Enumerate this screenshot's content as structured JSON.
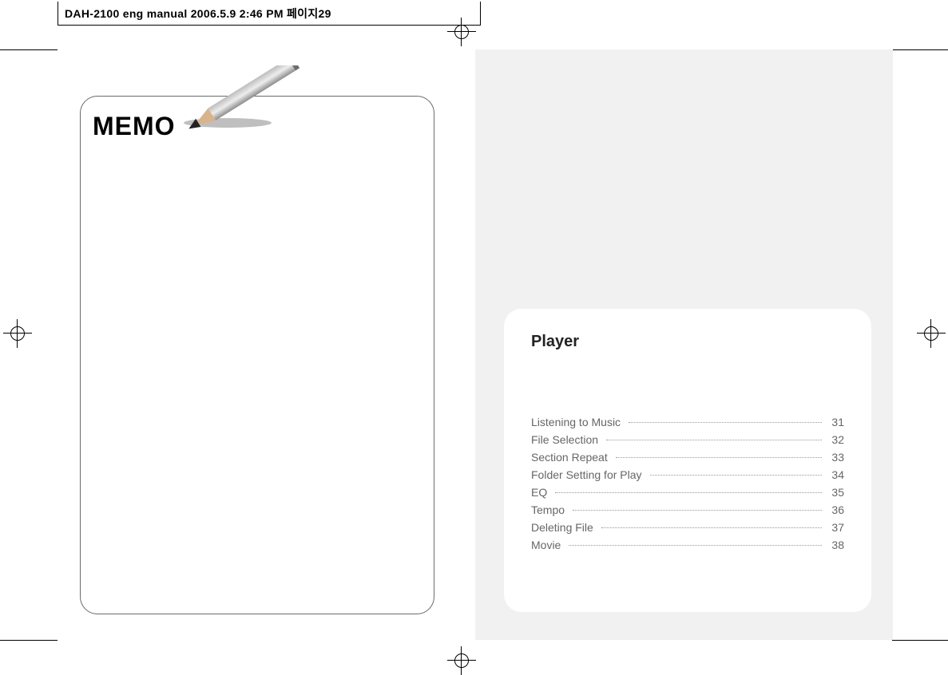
{
  "header": {
    "slug": "DAH-2100 eng manual  2006.5.9 2:46 PM  페이지29"
  },
  "left_page": {
    "memo_title": "MEMO"
  },
  "right_page": {
    "panel_title": "Player",
    "toc": [
      {
        "label": "Listening to Music",
        "page": "31"
      },
      {
        "label": "File Selection",
        "page": "32"
      },
      {
        "label": "Section Repeat",
        "page": "33"
      },
      {
        "label": "Folder Setting for Play",
        "page": "34"
      },
      {
        "label": "EQ",
        "page": "35"
      },
      {
        "label": "Tempo",
        "page": "36"
      },
      {
        "label": "Deleting File",
        "page": "37"
      },
      {
        "label": "Movie",
        "page": "38"
      }
    ]
  }
}
